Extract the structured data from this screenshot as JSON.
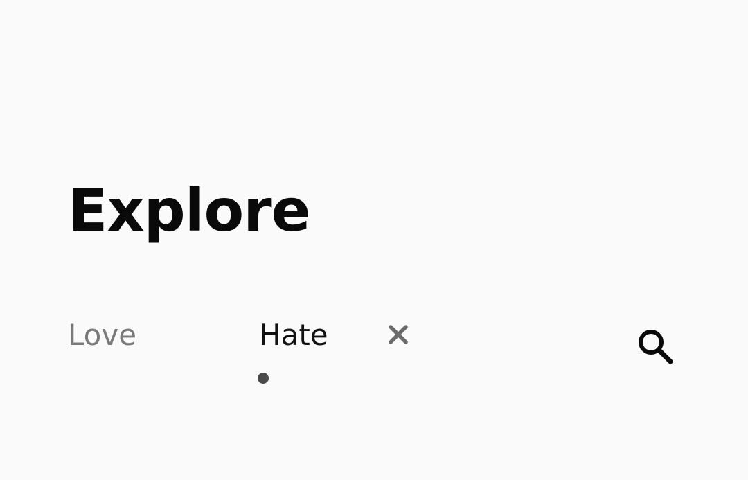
{
  "header": {
    "title": "Explore"
  },
  "tabs": [
    {
      "label": "Love",
      "active": false
    },
    {
      "label": "Hate",
      "active": true
    }
  ],
  "icons": {
    "close": "close-icon",
    "search": "search-icon"
  },
  "colors": {
    "background": "#fafafa",
    "title": "#0a0a0a",
    "active_tab": "#111111",
    "inactive_tab": "#7a7a7a",
    "indicator": "#4a4a4a",
    "close_icon": "#6b6b6b",
    "search_icon": "#0a0a0a"
  }
}
